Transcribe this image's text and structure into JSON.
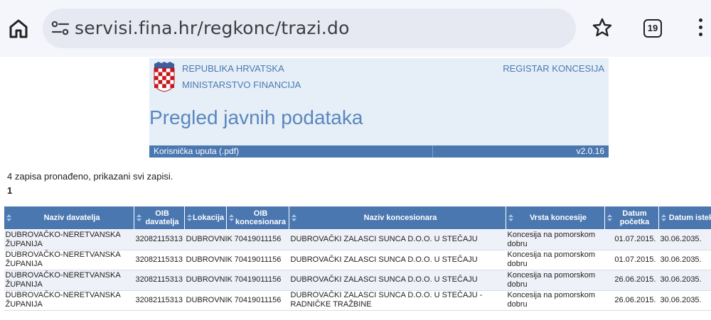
{
  "browser": {
    "url": "servisi.fina.hr/regkonc/trazi.do",
    "tab_count": "19"
  },
  "banner": {
    "republic": "REPUBLIKA HRVATSKA",
    "ministry": "MINISTARSTVO FINANCIJA",
    "registry": "REGISTAR KONCESIJA",
    "title": "Pregled javnih podataka",
    "user_guide": "Korisnička uputa (.pdf)",
    "version": "v2.0.16"
  },
  "results": {
    "count_text": "4 zapisa pronađeno, prikazani svi zapisi.",
    "page": "1"
  },
  "table": {
    "headers": [
      "Naziv davatelja",
      "OIB davatelja",
      "Lokacija",
      "OIB koncesionara",
      "Naziv koncesionara",
      "Vrsta koncesije",
      "Datum početka",
      "Datum isteka"
    ],
    "rows": [
      [
        "DUBROVAČKO-NERETVANSKA ŽUPANIJA",
        "32082115313",
        "DUBROVNIK",
        "70419011156",
        "DUBROVAČKI ZALASCI SUNCA D.O.O. U STEČAJU",
        "Koncesija na pomorskom dobru",
        "01.07.2015.",
        "30.06.2035."
      ],
      [
        "DUBROVAČKO-NERETVANSKA ŽUPANIJA",
        "32082115313",
        "DUBROVNIK",
        "70419011156",
        "DUBROVAČKI ZALASCI SUNCA D.O.O. U STEČAJU",
        "Koncesija na pomorskom dobru",
        "01.07.2015.",
        "30.06.2035."
      ],
      [
        "DUBROVAČKO-NERETVANSKA ŽUPANIJA",
        "32082115313",
        "DUBROVNIK",
        "70419011156",
        "DUBROVAČKI ZALASCI SUNCA D.O.O. U STEČAJU",
        "Koncesija na pomorskom dobru",
        "26.06.2015.",
        "30.06.2035."
      ],
      [
        "DUBROVAČKO-NERETVANSKA ŽUPANIJA",
        "32082115313",
        "DUBROVNIK",
        "70419011156",
        "DUBROVAČKI ZALASCI SUNCA D.O.O. U STEČAJU - RADNIČKE TRAŽBINE",
        "Koncesija na pomorskom dobru",
        "26.06.2015.",
        "30.06.2035."
      ]
    ]
  },
  "colors": {
    "header_blue": "#4a77b0",
    "banner_bg": "#e6eff8",
    "banner_text": "#4a79b0"
  },
  "icons": [
    "home-icon",
    "site-settings-icon",
    "star-icon",
    "tabs-icon",
    "more-menu-icon",
    "coat-of-arms-icon",
    "sort-icon"
  ]
}
